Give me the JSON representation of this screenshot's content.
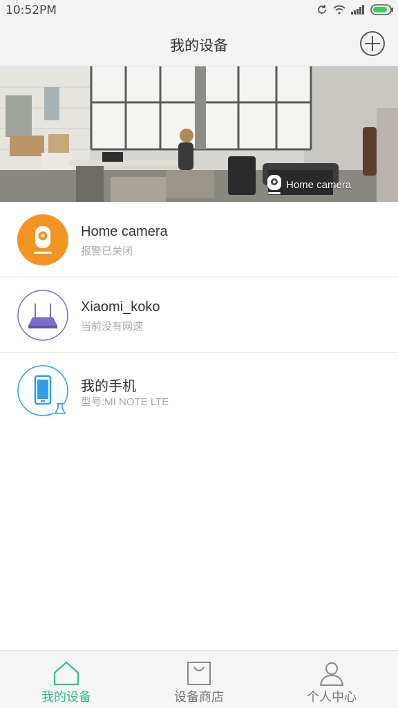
{
  "status_bar": {
    "time": "10:52PM"
  },
  "header": {
    "title": "我的设备",
    "add_icon": "plus-circle-icon"
  },
  "banner": {
    "label": "Home camera",
    "icon": "camera-icon"
  },
  "devices": [
    {
      "name": "Home camera",
      "subtitle": "报警已关闭",
      "icon": "camera-icon",
      "color": "#f29522"
    },
    {
      "name": "Xiaomi_koko",
      "subtitle": "当前没有网速",
      "icon": "router-icon",
      "color": "#7a6fc8"
    },
    {
      "name": "我的手机",
      "subtitle": "型号:MI NOTE LTE",
      "icon": "phone-icon",
      "color": "#2f9de9"
    }
  ],
  "tabs": [
    {
      "label": "我的设备",
      "icon": "home-icon",
      "active": true
    },
    {
      "label": "设备商店",
      "icon": "shopping-bag-icon",
      "active": false
    },
    {
      "label": "个人中心",
      "icon": "user-icon",
      "active": false
    }
  ],
  "colors": {
    "accent": "#2fbf8f",
    "header_bg": "#f3f3f3"
  }
}
